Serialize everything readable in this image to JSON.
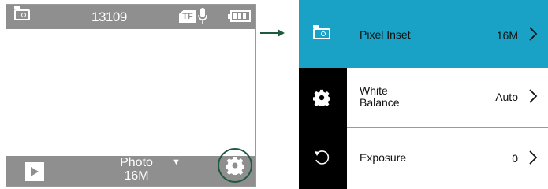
{
  "preview": {
    "topbar": {
      "counter": "13109",
      "storage_label": "TF",
      "icons": [
        "photo-mode-icon",
        "tf-card-icon",
        "microphone-icon",
        "battery-icon"
      ]
    },
    "bottombar": {
      "mode_label": "Photo",
      "mode_value": "16M",
      "icons": [
        "playback-icon",
        "dropdown-arrow-icon",
        "settings-gear-icon"
      ]
    },
    "accent": "#1f5a40"
  },
  "menu": {
    "accent": "#19a2c6",
    "items": [
      {
        "icon": "photo-mode-icon",
        "label": "Pixel Inset",
        "value": "16M",
        "selected": true
      },
      {
        "icon": "gear-icon",
        "label_line1": "White",
        "label_line2": "Balance",
        "value": "Auto",
        "selected": false
      },
      {
        "icon": "rotate-icon",
        "label": "Exposure",
        "value": "0",
        "selected": false
      }
    ]
  }
}
